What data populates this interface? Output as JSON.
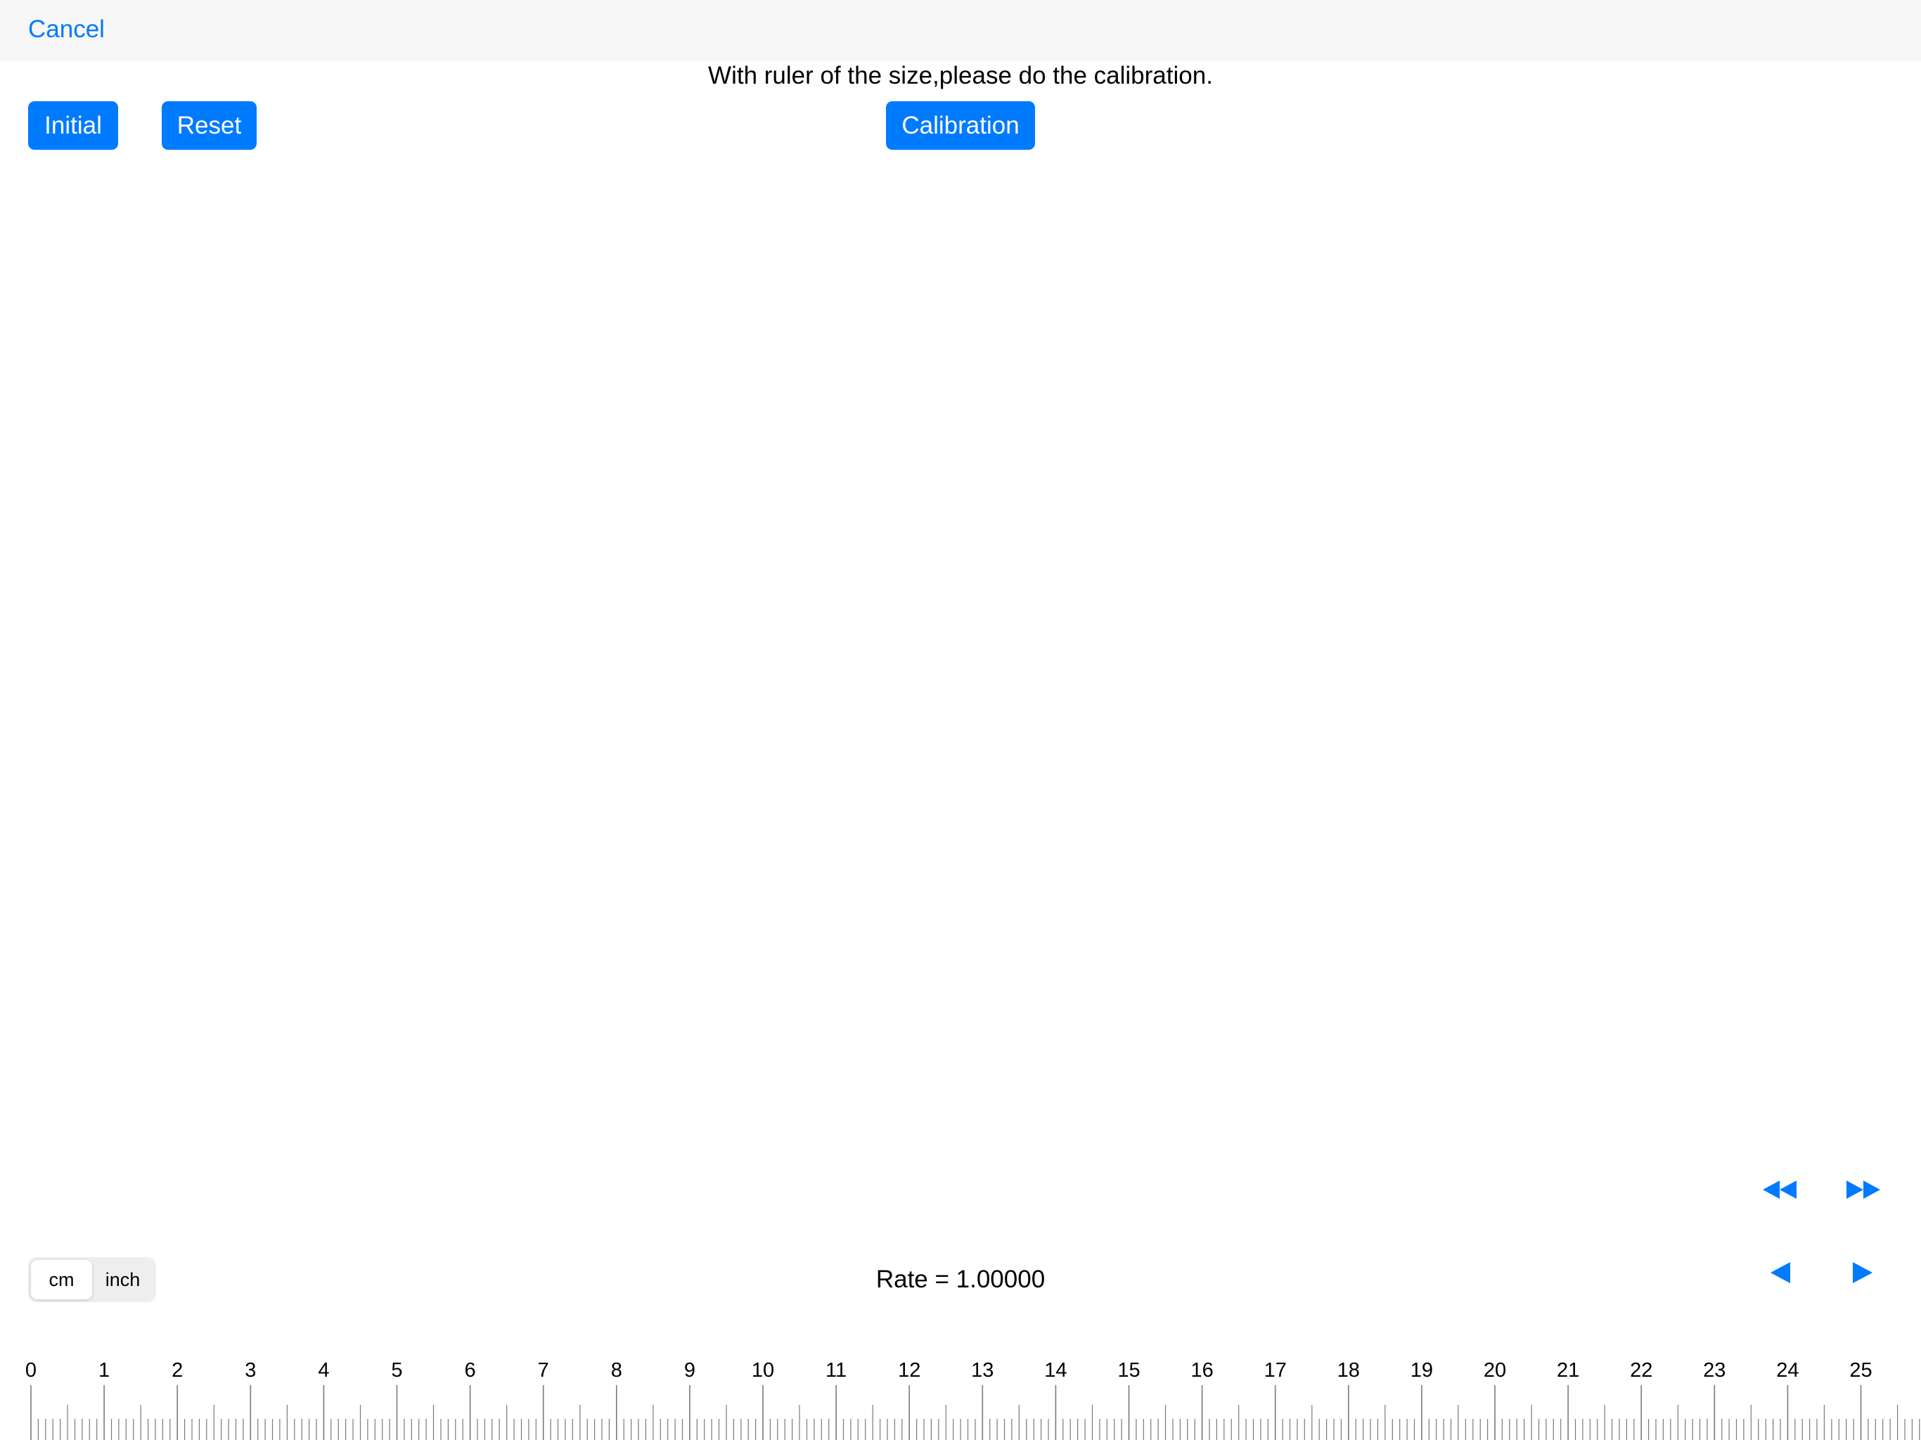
{
  "top_bar": {
    "cancel_label": "Cancel"
  },
  "instruction": "With ruler of the size,please do the calibration.",
  "buttons": {
    "initial": "Initial",
    "reset": "Reset",
    "calibration": "Calibration"
  },
  "nav_controls": {
    "rewind_icon": "double-left-arrow-icon",
    "fast_forward_icon": "double-right-arrow-icon",
    "step_left_icon": "left-triangle-icon",
    "step_right_icon": "right-triangle-icon"
  },
  "unit_selector": {
    "options": [
      "cm",
      "inch"
    ],
    "selected": "cm"
  },
  "rate_text": "Rate = 1.00000",
  "ruler": {
    "unit": "cm",
    "labels": [
      "0",
      "1",
      "2",
      "3",
      "4",
      "5",
      "6",
      "7",
      "8",
      "9",
      "10",
      "11",
      "12",
      "13",
      "14",
      "15",
      "16",
      "17",
      "18",
      "19",
      "20",
      "21",
      "22",
      "23",
      "24",
      "25"
    ],
    "minor_divisions_per_unit": 10
  },
  "colors": {
    "accent": "#007aff",
    "top_bar_bg": "#f7f7f7",
    "segment_bg": "#eeeeef",
    "tick": "#7a7a7a"
  }
}
